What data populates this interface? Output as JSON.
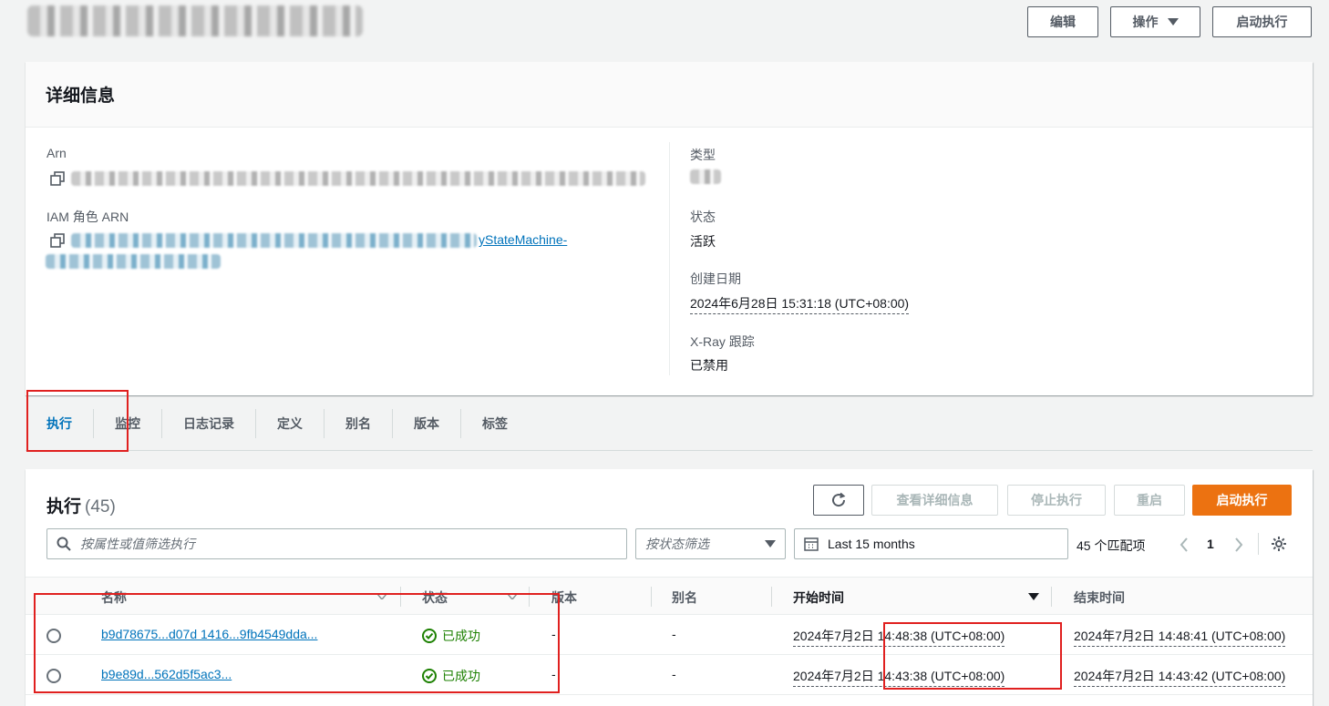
{
  "header": {
    "buttons": {
      "edit": "编辑",
      "actions": "操作",
      "start": "启动执行"
    }
  },
  "details": {
    "title": "详细信息",
    "arn_label": "Arn",
    "iam_label": "IAM 角色 ARN",
    "iam_value_visible": "yStateMachine-",
    "type_label": "类型",
    "status_label": "状态",
    "status_value": "活跃",
    "created_label": "创建日期",
    "created_value": "2024年6月28日 15:31:18 (UTC+08:00)",
    "xray_label": "X-Ray 跟踪",
    "xray_value": "已禁用"
  },
  "tabs": [
    "执行",
    "监控",
    "日志记录",
    "定义",
    "别名",
    "版本",
    "标签"
  ],
  "executions": {
    "title": "执行",
    "count": "(45)",
    "buttons": {
      "details": "查看详细信息",
      "stop": "停止执行",
      "redrive": "重启",
      "start": "启动执行"
    },
    "filter_placeholder": "按属性或值筛选执行",
    "status_filter_placeholder": "按状态筛选",
    "date_range": "Last 15 months",
    "matches": "45 个匹配项",
    "page": "1",
    "columns": [
      "名称",
      "状态",
      "版本",
      "别名",
      "开始时间",
      "结束时间"
    ],
    "rows": [
      {
        "name": "b9d78675...d07d 1416...9fb4549dda...",
        "status": "已成功",
        "version": "-",
        "alias": "-",
        "start": "2024年7月2日 14:48:38 (UTC+08:00)",
        "end": "2024年7月2日 14:48:41 (UTC+08:00)"
      },
      {
        "name": "b9e89d...562d5f5ac3...",
        "status": "已成功",
        "version": "-",
        "alias": "-",
        "start": "2024年7月2日 14:43:38 (UTC+08:00)",
        "end": "2024年7月2日 14:43:42 (UTC+08:00)"
      }
    ]
  },
  "colors": {
    "accent": "#0073bb",
    "primary": "#ec7211",
    "success": "#1d8102",
    "highlight": "#e0201f"
  }
}
